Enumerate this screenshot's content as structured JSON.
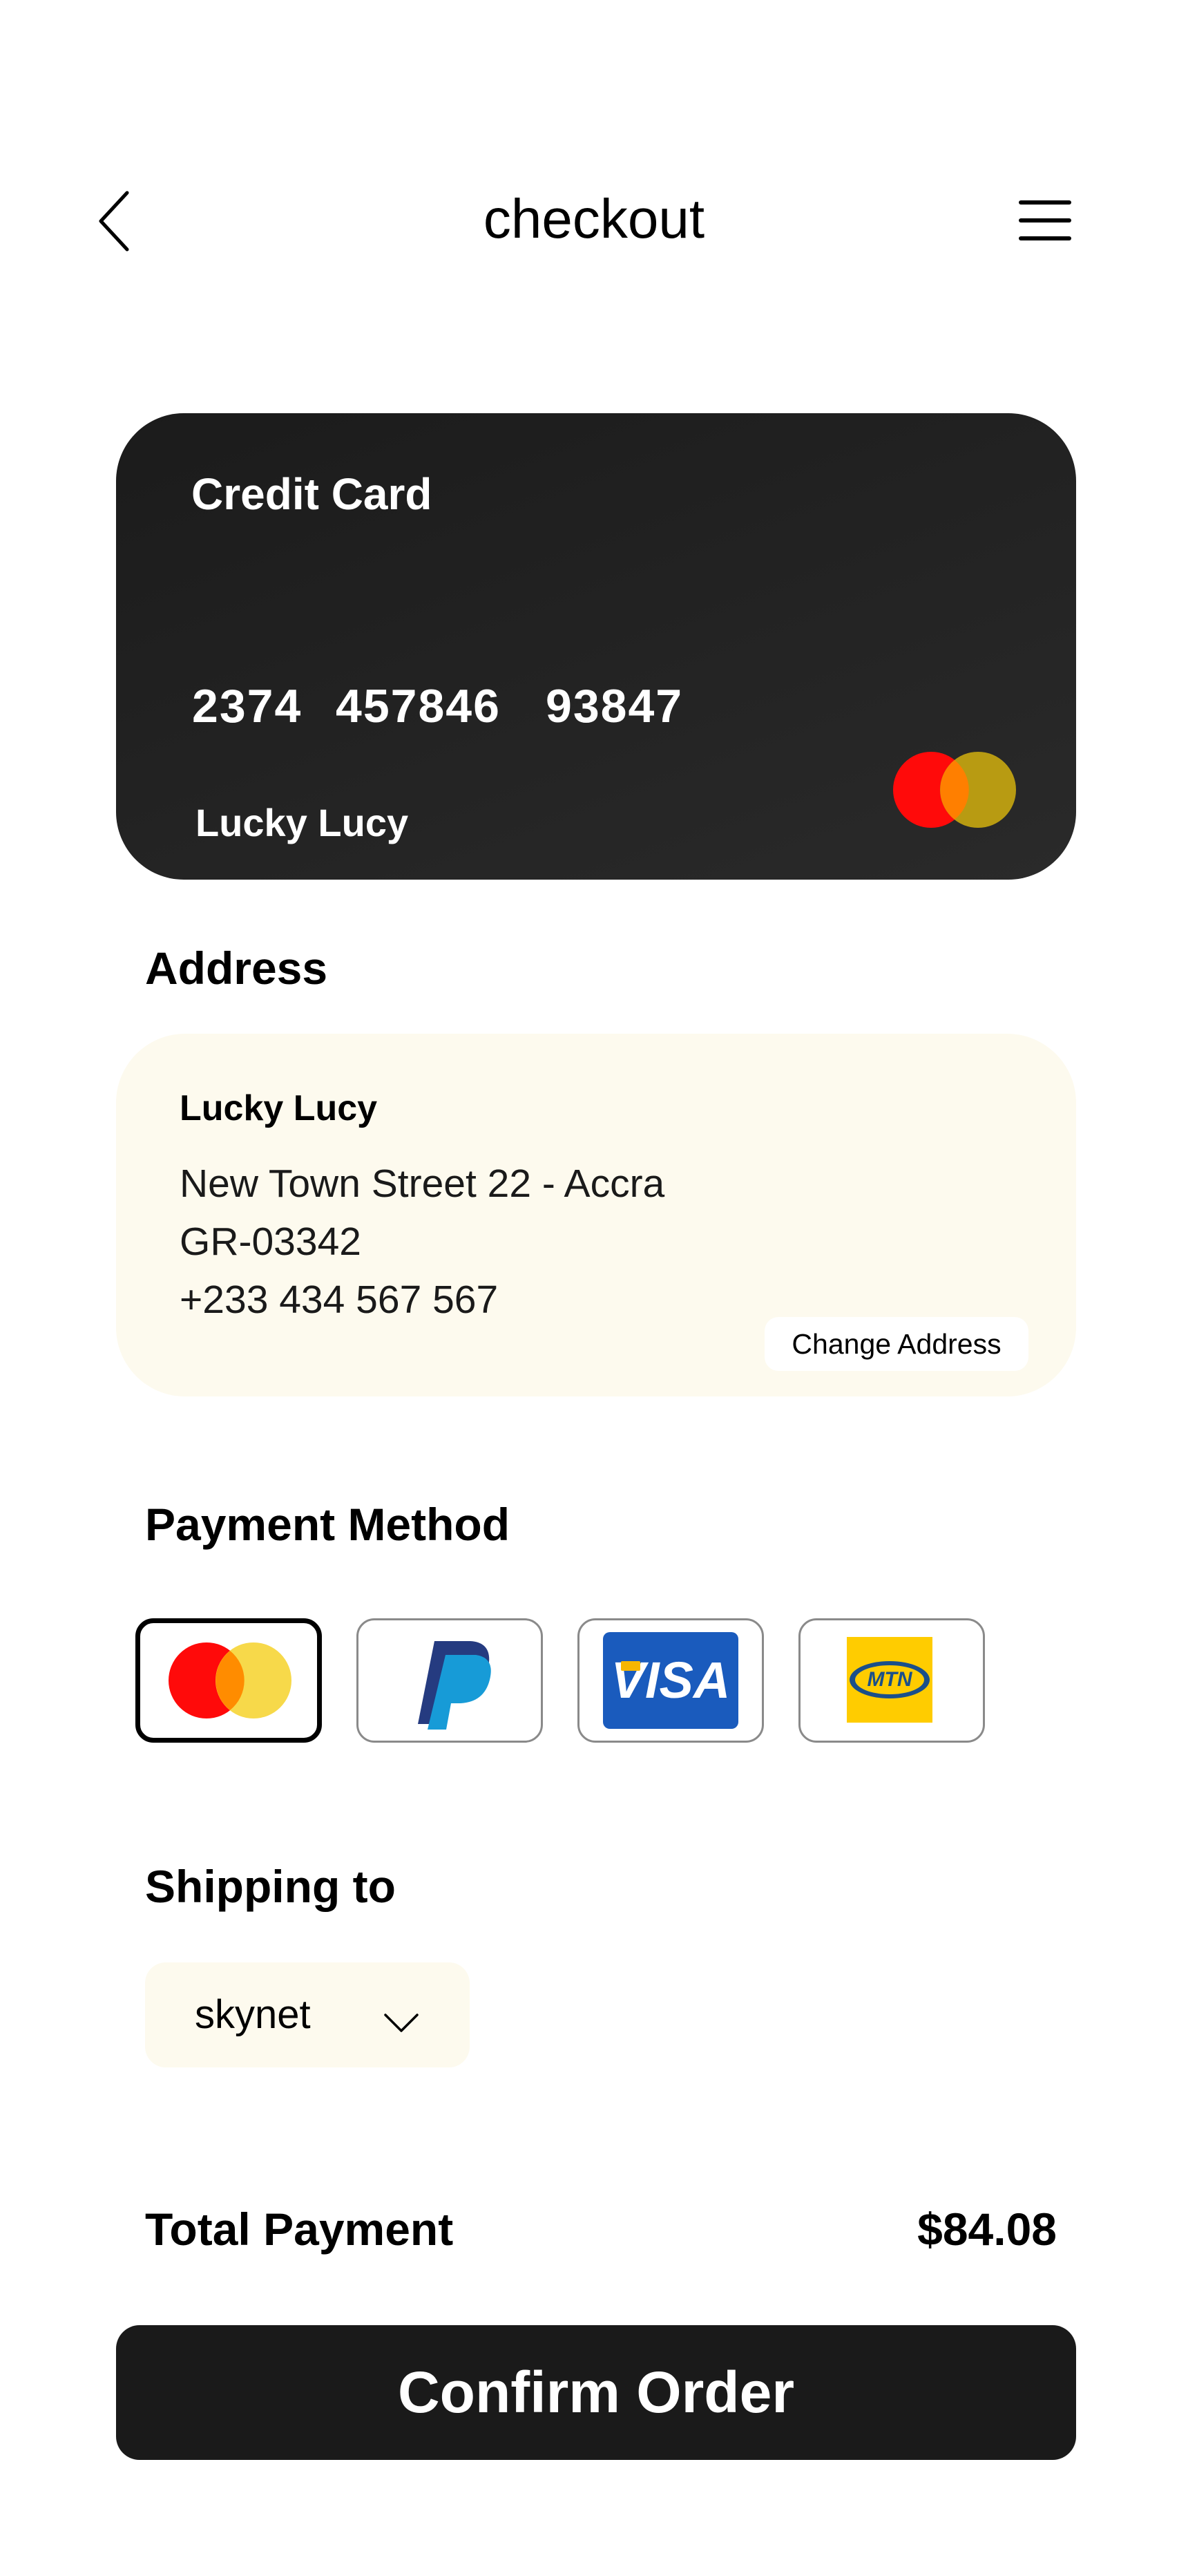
{
  "header": {
    "title": "checkout",
    "back_icon": "chevron-left-icon",
    "menu_icon": "hamburger-menu-icon"
  },
  "card": {
    "title": "Credit Card",
    "number_groups": [
      "2374",
      "457846",
      "93847"
    ],
    "holder": "Lucky Lucy",
    "brand_icon": "mastercard-icon",
    "background": "#1e1e1e"
  },
  "address": {
    "heading": "Address",
    "name": "Lucky Lucy",
    "street": "New Town Street 22 - Accra",
    "postal": "GR-03342",
    "phone": "+233 434 567 567",
    "change_label": "Change Address",
    "background": "#fdfaee"
  },
  "payment": {
    "heading": "Payment Method",
    "methods": [
      {
        "icon": "mastercard-icon",
        "selected": true
      },
      {
        "icon": "paypal-icon",
        "selected": false
      },
      {
        "icon": "visa-icon",
        "label": "VISA",
        "selected": false
      },
      {
        "icon": "mtn-icon",
        "label": "MTN",
        "selected": false
      }
    ]
  },
  "shipping": {
    "heading": "Shipping to",
    "selected": "skynet",
    "chevron_icon": "chevron-down-icon"
  },
  "total": {
    "label": "Total Payment",
    "value": "$84.08"
  },
  "confirm": {
    "label": "Confirm Order"
  },
  "colors": {
    "mastercard_red": "#ff0000",
    "mastercard_yellow": "#f7d32b",
    "visa_blue": "#1a5bbd",
    "mtn_yellow": "#ffcc00",
    "button_dark": "#1a1a1a"
  }
}
